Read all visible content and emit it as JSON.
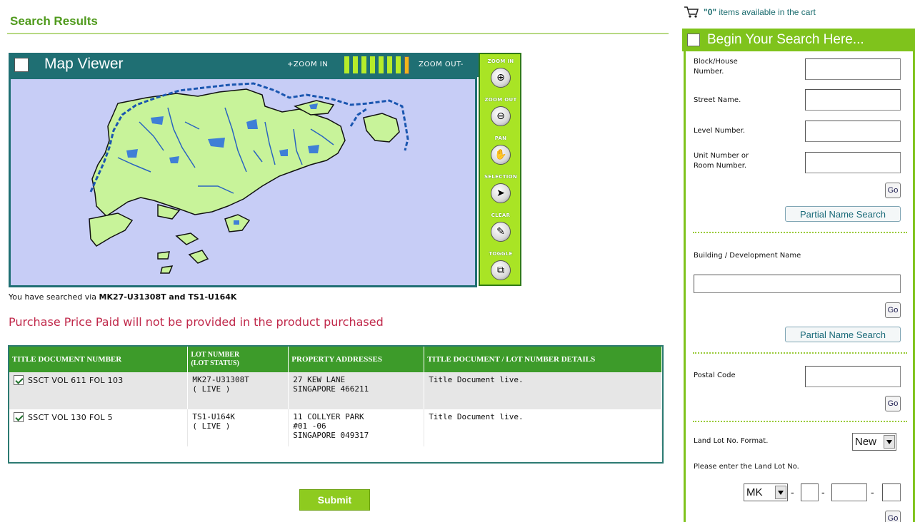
{
  "page": {
    "title": "Search Results"
  },
  "map_viewer": {
    "title": "Map Viewer",
    "zoom_in_label": "+ZOOM IN",
    "zoom_out_label": "ZOOM OUT-",
    "zoom_level_index": 7,
    "zoom_levels": 8,
    "tools": [
      {
        "label": "ZOOM IN",
        "icon": "zoom-in-icon",
        "glyph": "⊕"
      },
      {
        "label": "ZOOM OUT",
        "icon": "zoom-out-icon",
        "glyph": "⊖"
      },
      {
        "label": "PAN",
        "icon": "hand-pan-icon",
        "glyph": "✋"
      },
      {
        "label": "SELECTION",
        "icon": "cursor-select-icon",
        "glyph": "➤"
      },
      {
        "label": "CLEAR",
        "icon": "eraser-clear-icon",
        "glyph": "✎"
      },
      {
        "label": "TOGGLE",
        "icon": "toggle-layer-icon",
        "glyph": "⧉"
      }
    ]
  },
  "search_note": {
    "prefix": "You have searched via ",
    "query": "MK27-U31308T and TS1-U164K"
  },
  "price_note": "Purchase Price Paid will not be provided in the product purchased",
  "results": {
    "headers": [
      "TITLE DOCUMENT NUMBER",
      "LOT NUMBER (LOT STATUS)",
      "PROPERTY ADDRESSES",
      "TITLE DOCUMENT / LOT NUMBER DETAILS"
    ],
    "header_lot_line1": "LOT NUMBER",
    "header_lot_line2": "(LOT STATUS)",
    "rows": [
      {
        "checked": true,
        "title_doc": "SSCT VOL 611 FOL 103",
        "lot": "MK27-U31308T",
        "lot_status": "( LIVE )",
        "address": [
          "27 KEW LANE",
          "SINGAPORE 466211"
        ],
        "details": "Title Document live."
      },
      {
        "checked": true,
        "title_doc": "SSCT VOL 130 FOL 5",
        "lot": "TS1-U164K",
        "lot_status": "( LIVE )",
        "address": [
          "11 COLLYER PARK",
          "#01 -06",
          "SINGAPORE 049317"
        ],
        "details": "Title Document live."
      }
    ]
  },
  "submit_label": "Submit",
  "cart": {
    "count": "\"0\"",
    "text": " items available in the cart"
  },
  "sidebar": {
    "title": "Begin Your Search Here...",
    "block_label": "Block/House Number.",
    "street_label": "Street Name.",
    "level_label": "Level Number.",
    "unit_label": "Unit Number or Room Number.",
    "go_label": "Go",
    "partial_label": "Partial Name Search",
    "building_label": "Building / Development Name",
    "postal_label": "Postal Code",
    "land_lot_format_label": "Land Lot No. Format.",
    "land_lot_format_value": "New",
    "land_lot_enter_label": "Please enter the Land Lot No.",
    "land_lot_prefix_value": "MK",
    "dash": "-"
  },
  "colors": {
    "accent_green": "#7fc31c",
    "teal": "#1f6f73",
    "table_header": "#3d9b2a",
    "warning_red": "#c0284a"
  }
}
